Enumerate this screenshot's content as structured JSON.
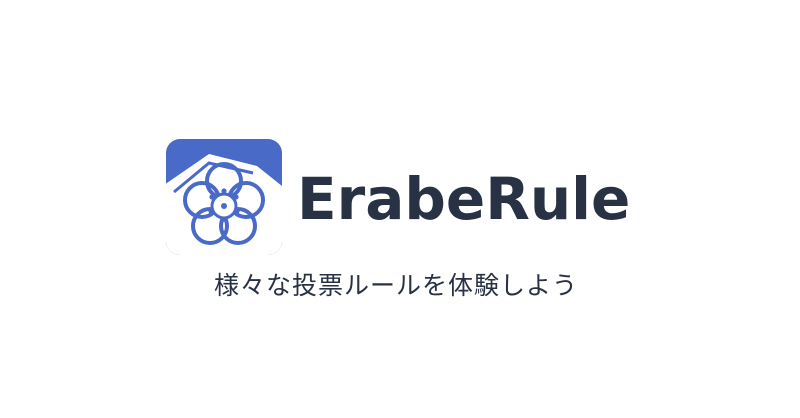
{
  "brand": {
    "name": "ErabeRule",
    "tagline": "様々な投票ルールを体験しよう",
    "logo_icon": "plum-blossom-logo-icon"
  },
  "colors": {
    "background": "#ffffff",
    "brand_blue": "#4a6ac8",
    "text": "#283244"
  }
}
